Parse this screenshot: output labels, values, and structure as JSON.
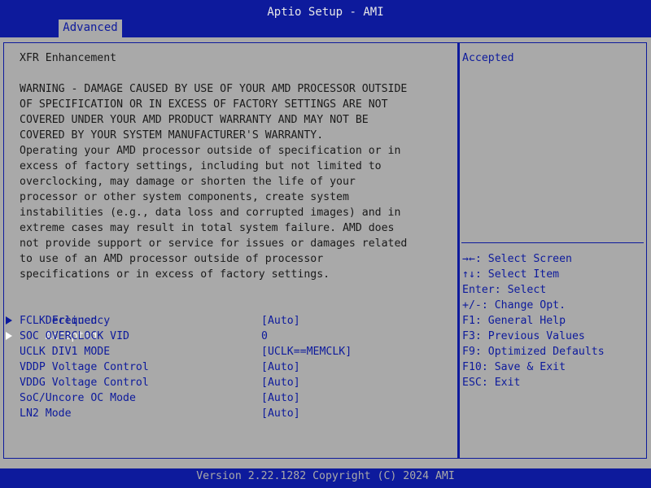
{
  "header": {
    "title": "Aptio Setup - AMI",
    "tab_label": "Advanced"
  },
  "main": {
    "heading": "XFR Enhancement",
    "warning_lines": [
      "WARNING - DAMAGE CAUSED BY USE OF YOUR AMD PROCESSOR OUTSIDE",
      "OF SPECIFICATION OR IN EXCESS OF FACTORY SETTINGS ARE NOT",
      "COVERED UNDER YOUR AMD PRODUCT WARRANTY AND MAY NOT BE",
      "COVERED BY YOUR SYSTEM MANUFACTURER'S WARRANTY.",
      "Operating your AMD processor outside of specification or in",
      "excess of factory settings, including but not limited to",
      "overclocking, may damage or shorten the life of your",
      "processor or other system components, create system",
      "instabilities (e.g., data loss and corrupted images) and in",
      "extreme cases may result in total system failure. AMD does",
      "not provide support or service for issues or damages related",
      "to use of an AMD processor outside of processor",
      "specifications or in excess of factory settings."
    ],
    "options": [
      {
        "label": "Declined",
        "selected": false
      },
      {
        "label": "Accepted",
        "selected": true
      }
    ],
    "settings": [
      {
        "label": "FCLK Frequency",
        "value": "[Auto]"
      },
      {
        "label": "SOC OVERCLOCK VID",
        "value": "0"
      },
      {
        "label": "UCLK DIV1 MODE",
        "value": "[UCLK==MEMCLK]"
      },
      {
        "label": "VDDP Voltage Control",
        "value": "[Auto]"
      },
      {
        "label": "VDDG Voltage Control",
        "value": "[Auto]"
      },
      {
        "label": "SoC/Uncore OC Mode",
        "value": "[Auto]"
      },
      {
        "label": "LN2 Mode",
        "value": "[Auto]"
      }
    ]
  },
  "help": {
    "text": "Accepted",
    "keys": [
      "→←: Select Screen",
      "↑↓: Select Item",
      "Enter: Select",
      "+/-: Change Opt.",
      "F1: General Help",
      "F3: Previous Values",
      "F9: Optimized Defaults",
      "F10: Save & Exit",
      "ESC: Exit"
    ]
  },
  "footer": {
    "version": "Version 2.22.1282 Copyright (C) 2024 AMI"
  },
  "colors": {
    "bios_blue": "#0d1a9c",
    "panel_gray": "#a9a9a9",
    "selected_white": "#ffffff"
  }
}
